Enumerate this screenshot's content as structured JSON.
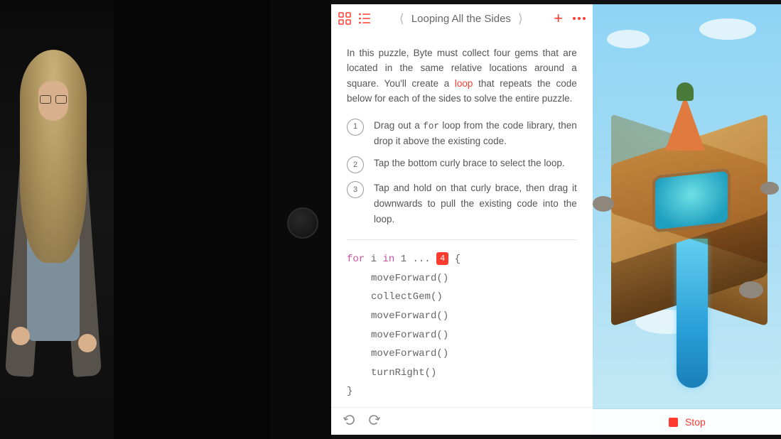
{
  "header": {
    "title": "Looping All the Sides"
  },
  "intro": {
    "text_before_loop": "In this puzzle, Byte must collect four gems that are located in the same relative locations around a square. You'll create a ",
    "loop_word": "loop",
    "text_after_loop": " that repeats the code below for each of the sides to solve the entire puzzle."
  },
  "steps": [
    {
      "num": "1",
      "pre": "Drag out a ",
      "mono": "for",
      "post": " loop from the code library, then drop it above the existing code."
    },
    {
      "num": "2",
      "pre": "Tap the bottom curly brace to select the loop.",
      "mono": "",
      "post": ""
    },
    {
      "num": "3",
      "pre": "Tap and hold on that curly brace, then drag it downwards to pull the existing code into the loop.",
      "mono": "",
      "post": ""
    }
  ],
  "code": {
    "line1_kw_for": "for",
    "line1_var": " i ",
    "line1_kw_in": "in",
    "line1_range": " 1 ... ",
    "line1_token": "4",
    "line1_brace": " {",
    "body": [
      "moveForward()",
      "collectGem()",
      "moveForward()",
      "moveForward()",
      "moveForward()",
      "turnRight()"
    ],
    "close_brace": "}"
  },
  "run": {
    "stop_label": "Stop"
  }
}
